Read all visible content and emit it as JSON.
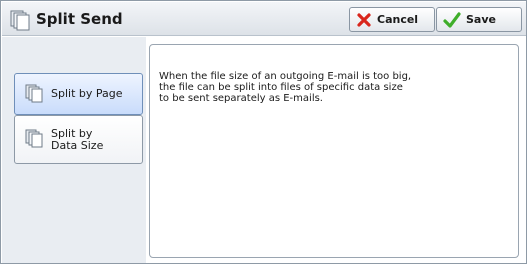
{
  "titlebar": {
    "title": "Split Send",
    "icon": "split-send-document-icon"
  },
  "toolbar": {
    "cancel_label": "Cancel",
    "cancel_icon": "red-x-icon",
    "save_label": "Save",
    "save_icon": "green-check-icon"
  },
  "options": [
    {
      "label": "Split by Page",
      "selected": true,
      "icon": "split-by-page-icon"
    },
    {
      "label": "Split by\nData Size",
      "selected": false,
      "icon": "split-by-data-size-icon"
    }
  ],
  "description": "When the file size of an outgoing E-mail is too big,\nthe file can be split into files of specific data size\nto be sent separately as E-mails.",
  "colors": {
    "selected_option": "#c9dcfb",
    "cancel_icon": "#d9261c",
    "save_icon": "#3fae2a"
  }
}
